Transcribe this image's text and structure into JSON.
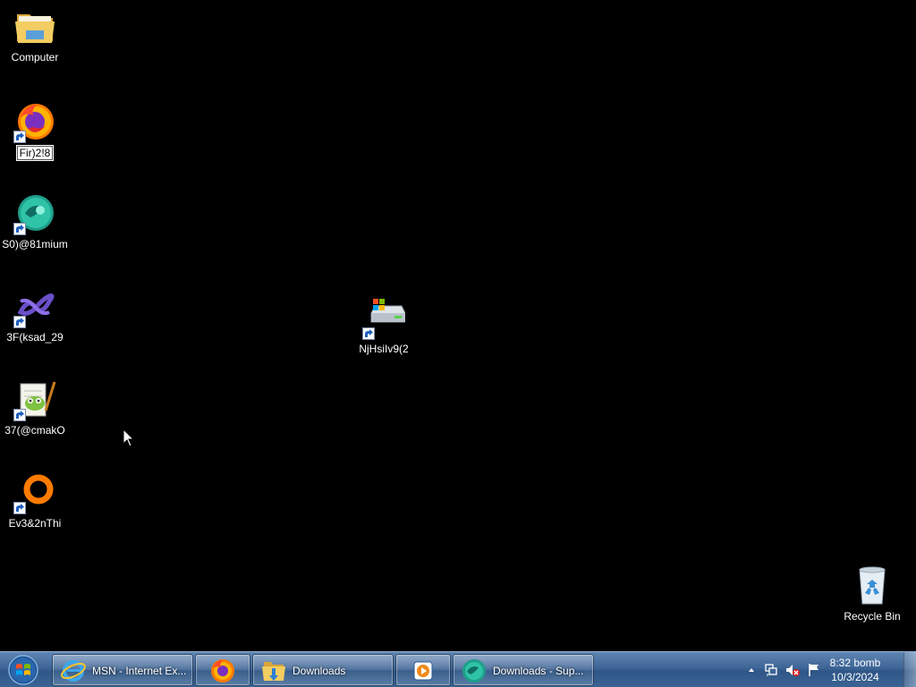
{
  "desktop": {
    "icons": [
      {
        "label": "Computer",
        "icon": "folder-icon"
      },
      {
        "label": "Fir)2!8",
        "icon": "firefox-icon",
        "editing": true
      },
      {
        "label": "S0)@81mium",
        "icon": "seamonkey-icon"
      },
      {
        "label": "3F(ksad_29",
        "icon": "visual-studio-icon"
      },
      {
        "label": "37(@cmakO",
        "icon": "notepad-plus-icon"
      },
      {
        "label": "Ev3&2nThi",
        "icon": "ring-icon"
      },
      {
        "label": "NjHsiIv9(2",
        "icon": "removable-drive-icon"
      },
      {
        "label": "Recycle Bin",
        "icon": "recycle-bin-icon"
      }
    ]
  },
  "taskbar": {
    "buttons": [
      {
        "label": "MSN - Internet Ex...",
        "icon": "internet-explorer-icon"
      },
      {
        "label": "",
        "icon": "firefox-icon"
      },
      {
        "label": "Downloads",
        "icon": "folder-icon"
      },
      {
        "label": "",
        "icon": "media-player-icon"
      },
      {
        "label": "Downloads - Sup...",
        "icon": "seamonkey-icon"
      }
    ],
    "clock": {
      "time": "8:32 bomb",
      "date": "10/3/2024"
    }
  }
}
